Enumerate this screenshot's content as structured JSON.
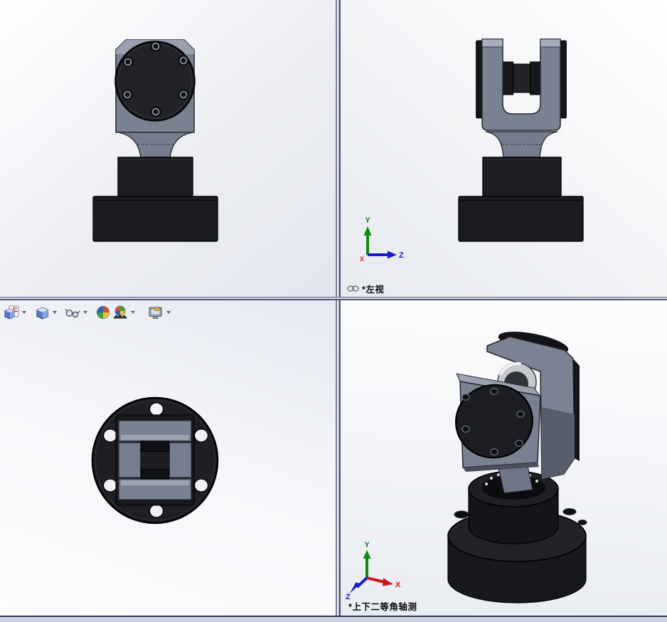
{
  "viewports": {
    "front": {
      "name": "front-view"
    },
    "left": {
      "name": "left-view",
      "label": "*左视",
      "link_icon": "link-icon"
    },
    "top": {
      "name": "top-view"
    },
    "isometric": {
      "name": "isometric-view",
      "label": "*上下二等角轴测"
    }
  },
  "triad": {
    "x": "X",
    "y": "Y",
    "z": "Z"
  },
  "toolbar": {
    "icons": [
      "view-orientation-icon",
      "display-style-icon",
      "hide-show-items-icon",
      "edit-appearance-icon",
      "apply-scene-icon",
      "view-settings-icon"
    ]
  },
  "colors": {
    "axis_x": "#cc1a1a",
    "axis_y": "#0e8a0e",
    "axis_z": "#1a1acc",
    "body_gray": "#7a8191",
    "body_gray_light": "#a6acb9",
    "body_black": "#1e1f23",
    "bearing_silver": "#c7c9ce",
    "divider_dark": "#50556e",
    "status_strip": "#ccd3e2"
  }
}
